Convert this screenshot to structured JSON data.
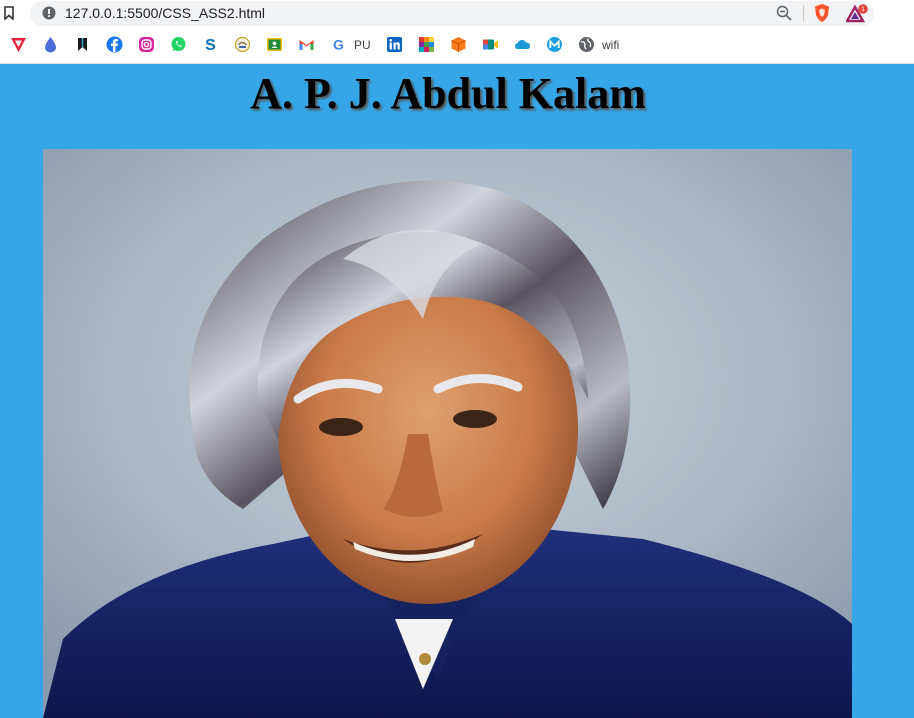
{
  "browser": {
    "url": "127.0.0.1:5500/CSS_ASS2.html",
    "rewards_badge": "1",
    "bookmarks": [
      {
        "icon": "vivaldi-icon",
        "color": "#e8233a"
      },
      {
        "icon": "pinterest-drop-icon",
        "color": "#4a6fd6"
      },
      {
        "icon": "bookmark-dark-icon",
        "color": "#1a1a1a"
      },
      {
        "icon": "facebook-icon",
        "color": "#1877f2"
      },
      {
        "icon": "instagram-icon",
        "color": "#d6249f"
      },
      {
        "icon": "whatsapp-icon",
        "color": "#25d366"
      },
      {
        "icon": "skype-icon",
        "color": "#0a6fb3"
      },
      {
        "icon": "crest-icon",
        "color": "#c9a227"
      },
      {
        "icon": "classroom-icon",
        "color": "#1e8e3e"
      },
      {
        "icon": "gmail-icon",
        "color": "#ea4335"
      },
      {
        "icon": "google-icon",
        "color": "#4285f4",
        "label": "PU"
      },
      {
        "icon": "linkedin-icon",
        "color": "#0a66c2"
      },
      {
        "icon": "colorful-grid-icon",
        "color": "#ff9800"
      },
      {
        "icon": "box-icon",
        "color": "#ff7a1a"
      },
      {
        "icon": "meet-icon",
        "color": "#00897b"
      },
      {
        "icon": "cloud-icon",
        "color": "#1a9bd7"
      },
      {
        "icon": "m-circle-icon",
        "color": "#18a0e0"
      },
      {
        "icon": "globe-icon",
        "color": "#5f6368",
        "label": "wifi"
      }
    ]
  },
  "page": {
    "title": "A. P. J. Abdul Kalam",
    "background_color": "#35a7e8",
    "portrait_alt": "A. P. J. Abdul Kalam"
  }
}
